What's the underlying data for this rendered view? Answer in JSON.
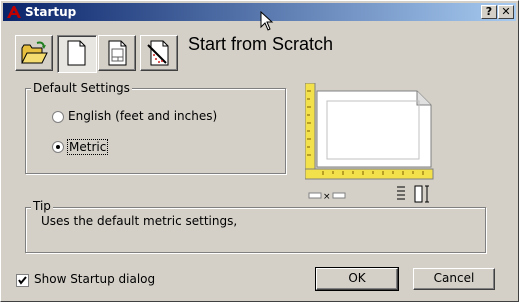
{
  "window": {
    "title": "Startup",
    "help_button": "?",
    "close_button": "✕"
  },
  "mode_buttons": [
    {
      "name": "Open a Drawing",
      "icon": "folder-open-icon"
    },
    {
      "name": "Start from Scratch",
      "icon": "blank-page-icon",
      "selected": true
    },
    {
      "name": "Use a Template",
      "icon": "template-page-icon"
    },
    {
      "name": "Use a Wizard",
      "icon": "wizard-page-icon"
    }
  ],
  "heading": "Start from Scratch",
  "default_settings": {
    "legend": "Default Settings",
    "options": [
      {
        "label": "English (feet and inches)",
        "selected": false
      },
      {
        "label": "Metric",
        "selected": true
      }
    ]
  },
  "preview": {
    "dim_separator": "×"
  },
  "tip": {
    "legend": "Tip",
    "text": "Uses the default metric settings,"
  },
  "footer": {
    "show_startup_label": "Show Startup dialog",
    "show_startup_checked": true,
    "ok_label": "OK",
    "cancel_label": "Cancel"
  },
  "colors": {
    "title_start": "#0a246a",
    "title_end": "#a6caf0",
    "face": "#d4d0c8",
    "ruler": "#f2e14a"
  }
}
